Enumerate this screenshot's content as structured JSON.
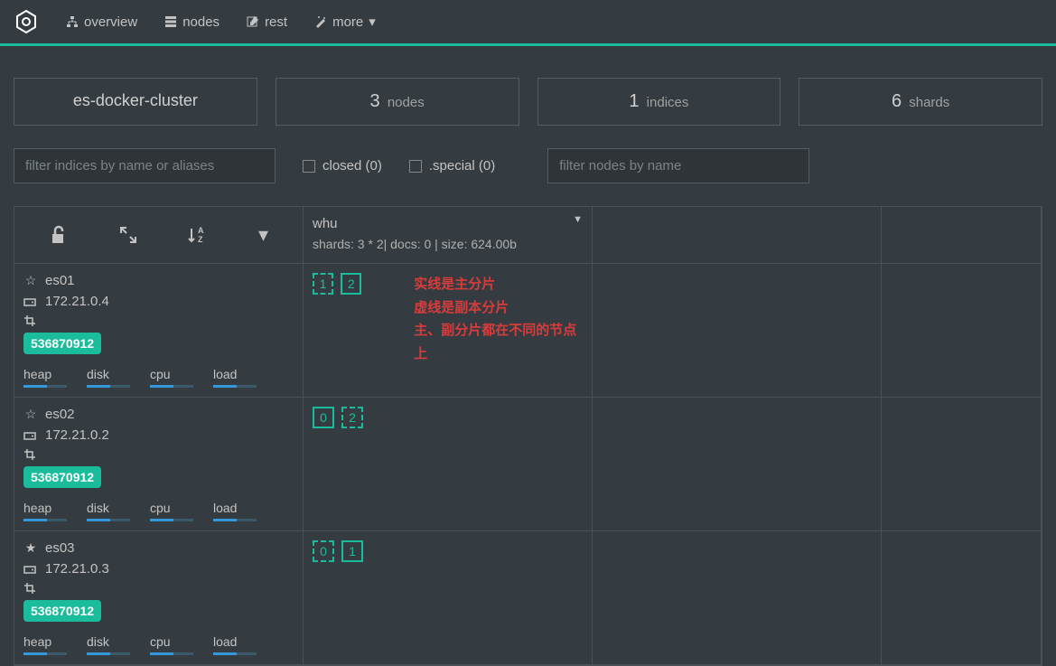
{
  "nav": {
    "items": [
      {
        "label": "overview"
      },
      {
        "label": "nodes"
      },
      {
        "label": "rest"
      },
      {
        "label": "more"
      }
    ]
  },
  "summary": {
    "cluster_name": "es-docker-cluster",
    "boxes": [
      {
        "num": "3",
        "label": "nodes"
      },
      {
        "num": "1",
        "label": "indices"
      },
      {
        "num": "6",
        "label": "shards"
      }
    ]
  },
  "filters": {
    "indices_placeholder": "filter indices by name or aliases",
    "closed_label": "closed (0)",
    "special_label": ".special (0)",
    "nodes_placeholder": "filter nodes by name"
  },
  "index": {
    "name": "whu",
    "stats": "shards: 3 * 2| docs: 0 | size: 624.00b"
  },
  "metrics_labels": {
    "heap": "heap",
    "disk": "disk",
    "cpu": "cpu",
    "load": "load"
  },
  "nodes": [
    {
      "name": "es01",
      "ip": "172.21.0.4",
      "badge": "536870912",
      "master": false,
      "shards": [
        {
          "num": "1",
          "type": "replica"
        },
        {
          "num": "2",
          "type": "primary"
        }
      ]
    },
    {
      "name": "es02",
      "ip": "172.21.0.2",
      "badge": "536870912",
      "master": false,
      "shards": [
        {
          "num": "0",
          "type": "primary"
        },
        {
          "num": "2",
          "type": "replica"
        }
      ]
    },
    {
      "name": "es03",
      "ip": "172.21.0.3",
      "badge": "536870912",
      "master": true,
      "shards": [
        {
          "num": "0",
          "type": "replica"
        },
        {
          "num": "1",
          "type": "primary"
        }
      ]
    }
  ],
  "annotation": {
    "line1": "实线是主分片",
    "line2": "虚线是副本分片",
    "line3": "主、副分片都在不同的节点上"
  }
}
